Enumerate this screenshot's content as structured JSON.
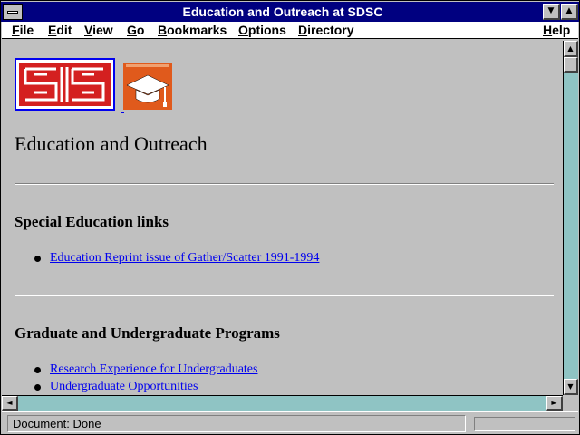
{
  "window": {
    "title": "Education and Outreach at SDSC"
  },
  "menubar": {
    "items": [
      {
        "accel": "F",
        "rest": "ile"
      },
      {
        "accel": "E",
        "rest": "dit"
      },
      {
        "accel": "V",
        "rest": "iew"
      },
      {
        "accel": "G",
        "rest": "o"
      },
      {
        "accel": "B",
        "rest": "ookmarks"
      },
      {
        "accel": "O",
        "rest": "ptions"
      },
      {
        "accel": "D",
        "rest": "irectory"
      },
      {
        "accel": "H",
        "rest": "elp"
      }
    ]
  },
  "page": {
    "heading": "Education and Outreach",
    "sections": [
      {
        "title": "Special Education links",
        "links": [
          "Education Reprint issue of Gather/Scatter 1991-1994"
        ]
      },
      {
        "title": "Graduate and Undergraduate Programs",
        "links": [
          "Research Experience for Undergraduates",
          "Undergraduate Opportunities"
        ]
      }
    ]
  },
  "status": {
    "text": "Document: Done"
  },
  "colors": {
    "title_bar": "#000080",
    "link": "#0000ee",
    "scroll_track": "#8fc4c4",
    "cap_logo": "#e05a1c",
    "sdsc_logo": "#d42020"
  },
  "icons": [
    "system-menu-icon",
    "minimize-icon",
    "maximize-icon",
    "sdsc-logo",
    "graduation-cap-logo",
    "scroll-up-icon",
    "scroll-down-icon",
    "scroll-left-icon",
    "scroll-right-icon"
  ]
}
